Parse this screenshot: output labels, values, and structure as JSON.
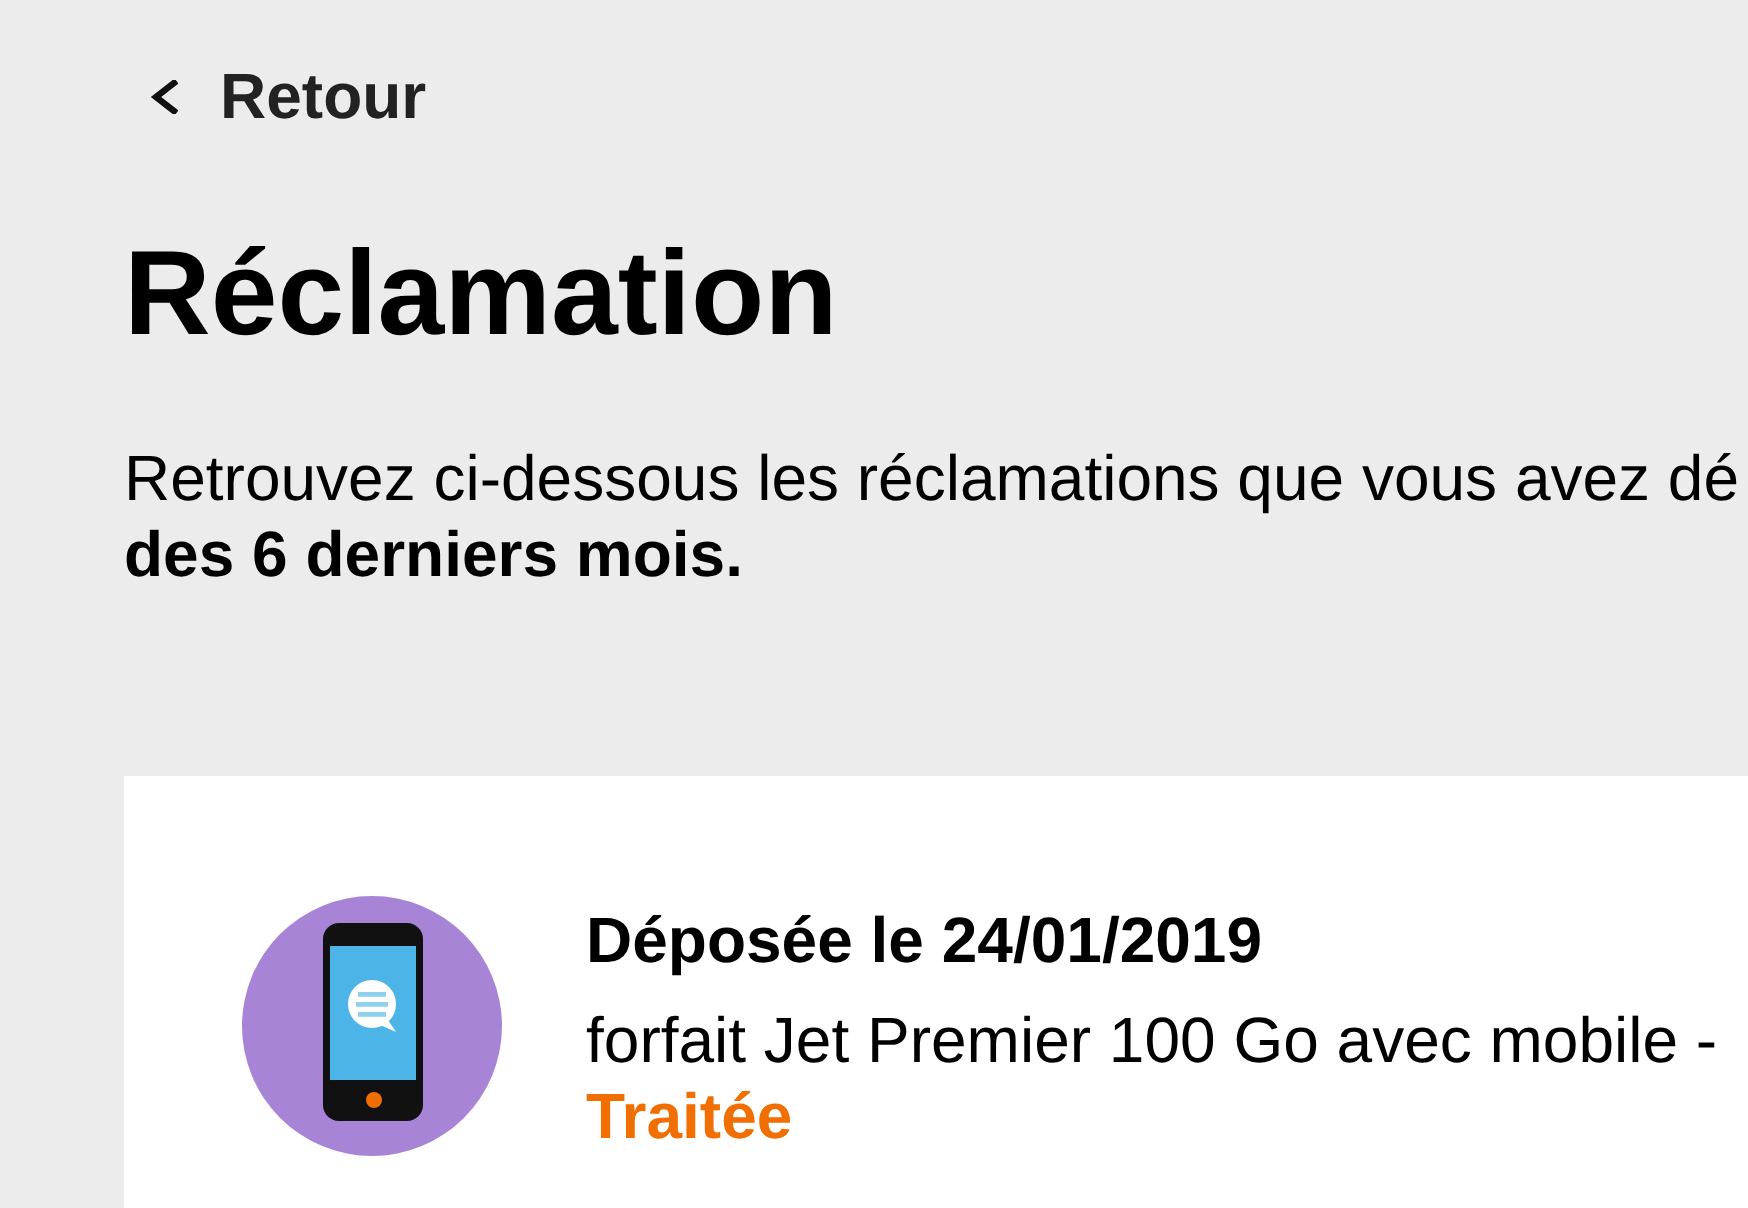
{
  "back_link": {
    "label": "Retour"
  },
  "title": "Réclamation",
  "intro": {
    "lines": [
      "Retrouvez ci-dessous les réclamations que vous avez dé",
      "**des 6 derniers mois.**"
    ]
  },
  "claims": [
    {
      "date_label": "Déposée le 24/01/2019",
      "description": "forfait Jet Premier 100 Go avec mobile -",
      "status": {
        "label": "Traitée",
        "color": "#f16e00"
      }
    }
  ]
}
